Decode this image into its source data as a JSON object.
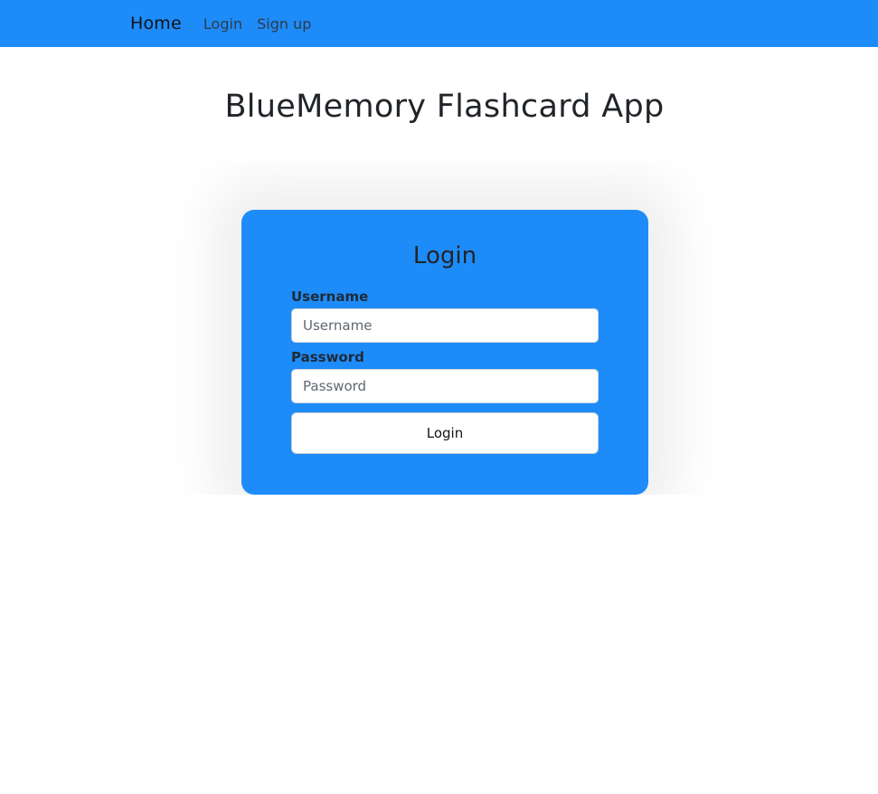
{
  "nav": {
    "brand": "Home",
    "links": [
      "Login",
      "Sign up"
    ]
  },
  "page": {
    "title": "BlueMemory Flashcard App"
  },
  "login_form": {
    "title": "Login",
    "username_label": "Username",
    "username_placeholder": "Username",
    "username_value": "",
    "password_label": "Password",
    "password_placeholder": "Password",
    "password_value": "",
    "submit_label": "Login"
  },
  "colors": {
    "brand_blue": "#1e8cf8",
    "page_background": "#ffffff",
    "text_dark": "#212529"
  }
}
